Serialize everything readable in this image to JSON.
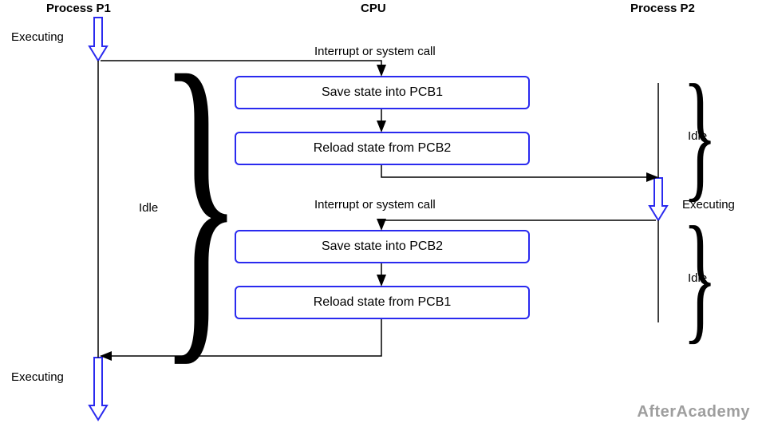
{
  "headers": {
    "p1": "Process P1",
    "cpu": "CPU",
    "p2": "Process P2"
  },
  "p1": {
    "exec_top": "Executing",
    "idle": "Idle",
    "exec_bottom": "Executing"
  },
  "p2": {
    "idle_top": "Idle",
    "exec": "Executing",
    "idle_bottom": "Idle"
  },
  "events": {
    "interrupt1": "Interrupt or system call",
    "interrupt2": "Interrupt or system call"
  },
  "boxes": {
    "save1": "Save state into PCB1",
    "reload1": "Reload state from PCB2",
    "save2": "Save state into PCB2",
    "reload2": "Reload state from PCB1"
  },
  "watermark": "AfterAcademy"
}
